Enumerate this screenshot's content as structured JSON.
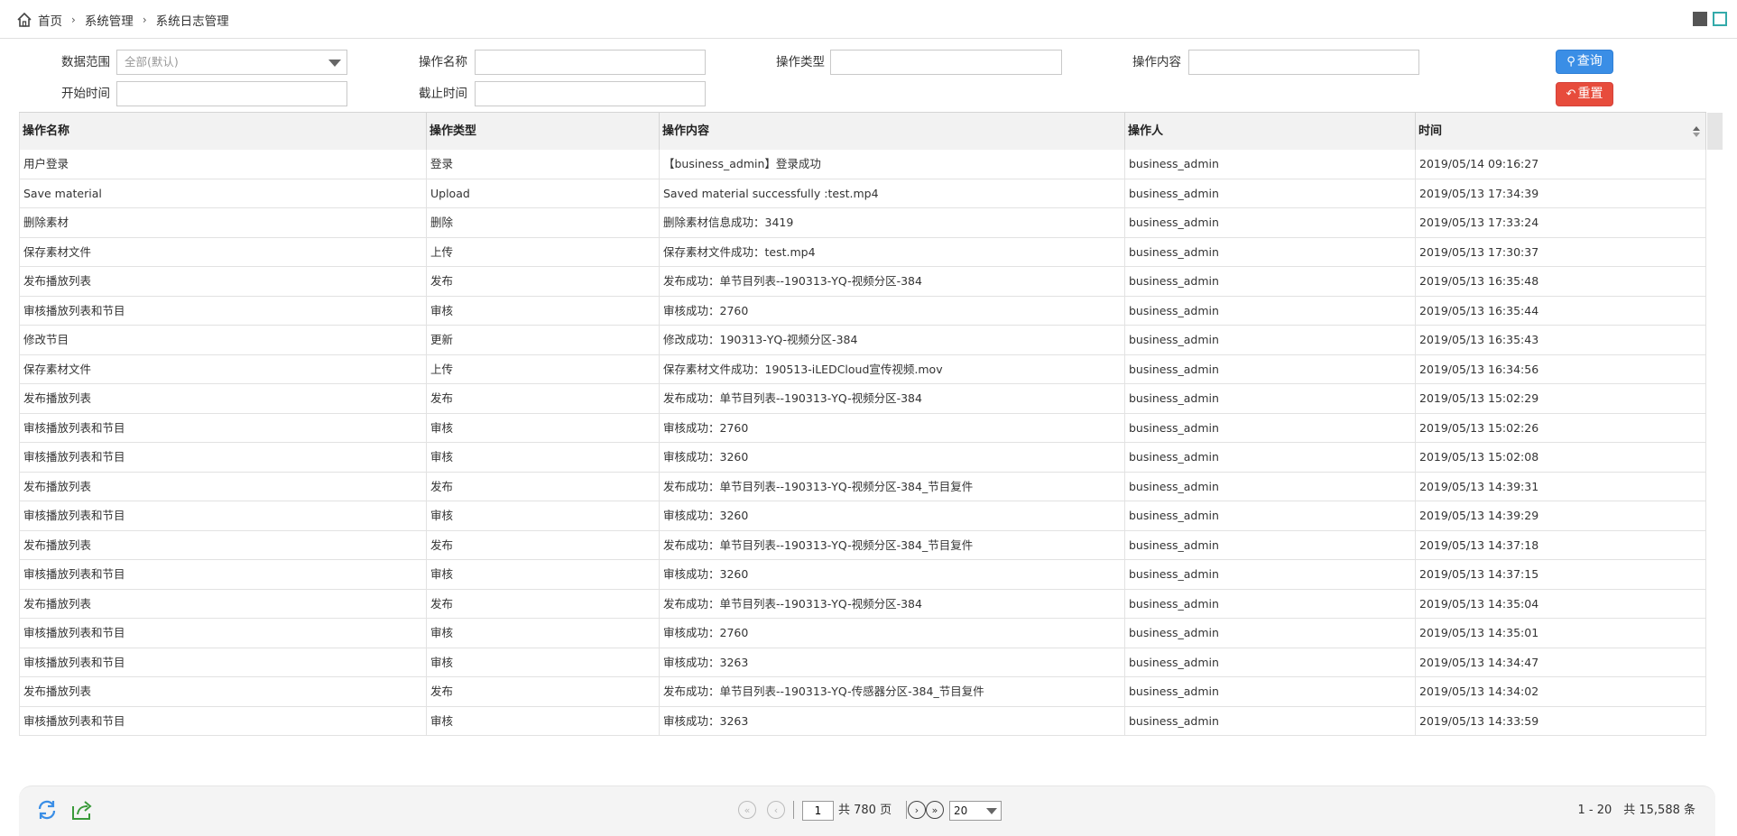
{
  "breadcrumb": {
    "home": "首页",
    "level1": "系统管理",
    "level2": "系统日志管理",
    "separator": "›"
  },
  "filters": {
    "data_range_label": "数据范围",
    "data_range_value": "全部(默认)",
    "op_name_label": "操作名称",
    "op_type_label": "操作类型",
    "op_content_label": "操作内容",
    "start_time_label": "开始时间",
    "end_time_label": "截止时间",
    "query_label": "查询",
    "reset_label": "重置"
  },
  "table": {
    "columns": [
      "操作名称",
      "操作类型",
      "操作内容",
      "操作人",
      "时间"
    ],
    "rows": [
      [
        "用户登录",
        "登录",
        "【business_admin】登录成功",
        "business_admin",
        "2019/05/14 09:16:27"
      ],
      [
        "Save material",
        "Upload",
        "Saved material successfully :test.mp4",
        "business_admin",
        "2019/05/13 17:34:39"
      ],
      [
        "删除素材",
        "删除",
        "删除素材信息成功：3419",
        "business_admin",
        "2019/05/13 17:33:24"
      ],
      [
        "保存素材文件",
        "上传",
        "保存素材文件成功：test.mp4",
        "business_admin",
        "2019/05/13 17:30:37"
      ],
      [
        "发布播放列表",
        "发布",
        "发布成功：单节目列表--190313-YQ-视频分区-384",
        "business_admin",
        "2019/05/13 16:35:48"
      ],
      [
        "审核播放列表和节目",
        "审核",
        "审核成功：2760",
        "business_admin",
        "2019/05/13 16:35:44"
      ],
      [
        "修改节目",
        "更新",
        "修改成功：190313-YQ-视频分区-384",
        "business_admin",
        "2019/05/13 16:35:43"
      ],
      [
        "保存素材文件",
        "上传",
        "保存素材文件成功：190513-iLEDCloud宣传视频.mov",
        "business_admin",
        "2019/05/13 16:34:56"
      ],
      [
        "发布播放列表",
        "发布",
        "发布成功：单节目列表--190313-YQ-视频分区-384",
        "business_admin",
        "2019/05/13 15:02:29"
      ],
      [
        "审核播放列表和节目",
        "审核",
        "审核成功：2760",
        "business_admin",
        "2019/05/13 15:02:26"
      ],
      [
        "审核播放列表和节目",
        "审核",
        "审核成功：3260",
        "business_admin",
        "2019/05/13 15:02:08"
      ],
      [
        "发布播放列表",
        "发布",
        "发布成功：单节目列表--190313-YQ-视频分区-384_节目复件",
        "business_admin",
        "2019/05/13 14:39:31"
      ],
      [
        "审核播放列表和节目",
        "审核",
        "审核成功：3260",
        "business_admin",
        "2019/05/13 14:39:29"
      ],
      [
        "发布播放列表",
        "发布",
        "发布成功：单节目列表--190313-YQ-视频分区-384_节目复件",
        "business_admin",
        "2019/05/13 14:37:18"
      ],
      [
        "审核播放列表和节目",
        "审核",
        "审核成功：3260",
        "business_admin",
        "2019/05/13 14:37:15"
      ],
      [
        "发布播放列表",
        "发布",
        "发布成功：单节目列表--190313-YQ-视频分区-384",
        "business_admin",
        "2019/05/13 14:35:04"
      ],
      [
        "审核播放列表和节目",
        "审核",
        "审核成功：2760",
        "business_admin",
        "2019/05/13 14:35:01"
      ],
      [
        "审核播放列表和节目",
        "审核",
        "审核成功：3263",
        "business_admin",
        "2019/05/13 14:34:47"
      ],
      [
        "发布播放列表",
        "发布",
        "发布成功：单节目列表--190313-YQ-传感器分区-384_节目复件",
        "business_admin",
        "2019/05/13 14:34:02"
      ],
      [
        "审核播放列表和节目",
        "审核",
        "审核成功：3263",
        "business_admin",
        "2019/05/13 14:33:59"
      ]
    ]
  },
  "pager": {
    "current_page": "1",
    "total_pages_text": "共 780 页",
    "page_size": "20",
    "range_text": "1 - 20　共 15,588 条"
  },
  "colors": {
    "query": "#3a8ee6",
    "reset": "#e74c3c",
    "header_bg": "#f2f2f2"
  },
  "icons": [
    "home-icon",
    "refresh-icon",
    "export-icon",
    "first-page-icon",
    "prev-page-icon",
    "next-page-icon",
    "last-page-icon",
    "search-icon",
    "reset-icon",
    "sort-icon"
  ]
}
